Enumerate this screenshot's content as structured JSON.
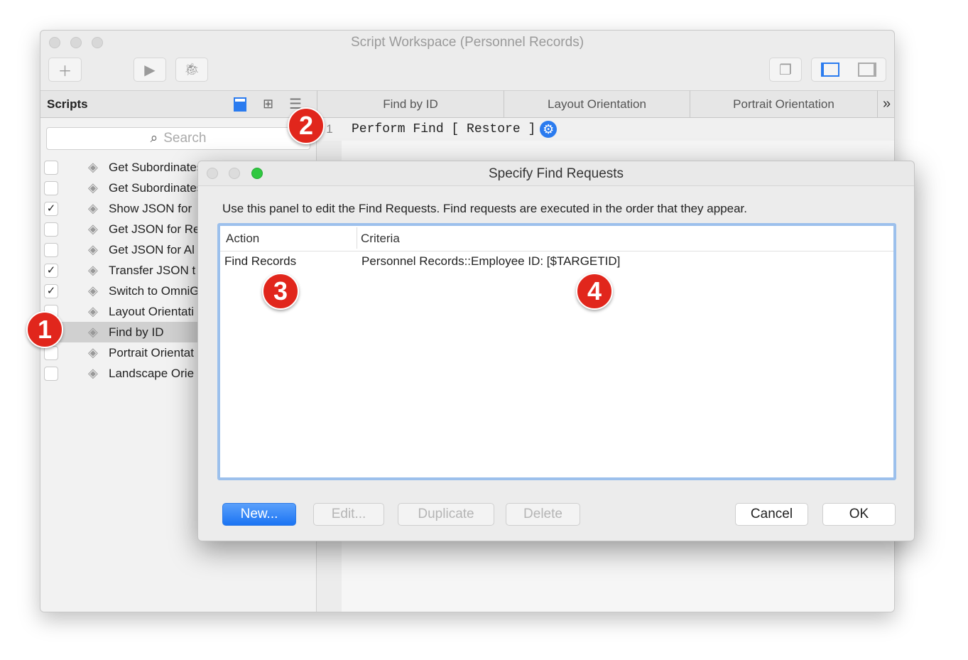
{
  "window": {
    "title": "Script Workspace (Personnel Records)"
  },
  "toolbar": {
    "new_icon": "plus-icon",
    "run_icon": "play-icon",
    "debug_icon": "bug-icon",
    "windows_icon": "stacked-windows-icon",
    "left_pane_icon": "left-sidebar-icon",
    "right_pane_icon": "right-sidebar-icon"
  },
  "scripts_panel": {
    "title": "Scripts",
    "search_placeholder": "Search",
    "items": [
      {
        "label": "Get Subordinates",
        "checked": false
      },
      {
        "label": "Get Subordinates",
        "checked": false
      },
      {
        "label": "Show JSON for",
        "checked": true
      },
      {
        "label": "Get JSON for Re",
        "checked": false
      },
      {
        "label": "Get JSON for Al",
        "checked": false
      },
      {
        "label": "Transfer JSON t",
        "checked": true
      },
      {
        "label": "Switch to OmniG",
        "checked": true
      },
      {
        "label": "Layout Orientati",
        "checked": false
      },
      {
        "label": "Find by ID",
        "checked": false,
        "selected": true
      },
      {
        "label": "Portrait Orientat",
        "checked": false
      },
      {
        "label": "Landscape Orie",
        "checked": false
      }
    ]
  },
  "tabs": [
    {
      "label": "Find by ID"
    },
    {
      "label": "Layout Orientation"
    },
    {
      "label": "Portrait Orientation"
    }
  ],
  "tabs_overflow": "»",
  "editor": {
    "line_number": "1",
    "code": "Perform Find [ Restore ]"
  },
  "dialog": {
    "title": "Specify Find Requests",
    "instructions": "Use this panel to edit the Find Requests. Find requests are executed in the order that they appear.",
    "columns": [
      "Action",
      "Criteria"
    ],
    "rows": [
      {
        "action": "Find Records",
        "criteria": "Personnel Records::Employee ID: [$TARGETID]"
      }
    ],
    "buttons": {
      "new": "New...",
      "edit": "Edit...",
      "duplicate": "Duplicate",
      "delete": "Delete",
      "cancel": "Cancel",
      "ok": "OK"
    }
  },
  "annotations": [
    "1",
    "2",
    "3",
    "4"
  ],
  "colors": {
    "accent": "#1b74f3",
    "badge": "#e1261c",
    "table_focus": "#9cc0ec"
  }
}
